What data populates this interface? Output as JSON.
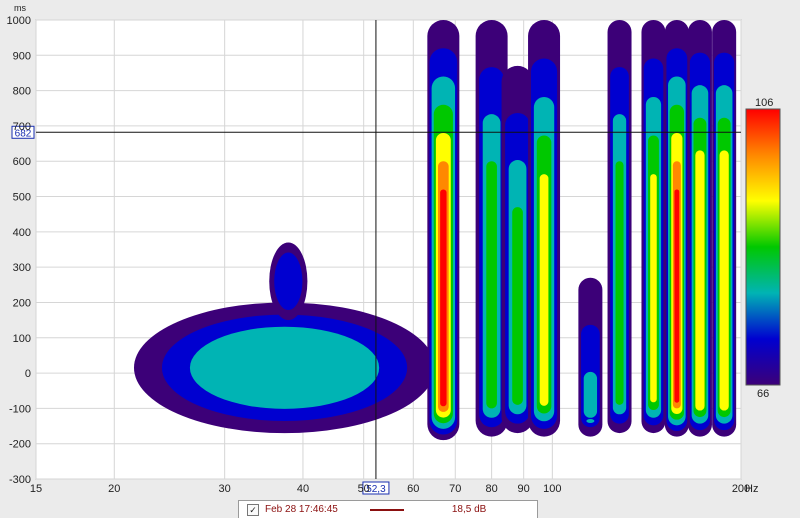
{
  "chart_data": {
    "type": "heatmap",
    "title": "",
    "xlabel": "",
    "ylabel": "",
    "x_unit": "Hz",
    "y_unit": "ms",
    "x_scale": "log",
    "xlim": [
      15,
      200
    ],
    "ylim": [
      -300,
      1000
    ],
    "x_ticks": [
      15,
      20,
      30,
      40,
      50,
      60,
      70,
      80,
      90,
      100,
      200
    ],
    "y_ticks": [
      -300,
      -200,
      -100,
      0,
      100,
      200,
      300,
      400,
      500,
      600,
      700,
      800,
      900,
      1000
    ],
    "color_scale": {
      "max": 106,
      "min": 66,
      "colors": [
        "#ff0000",
        "#ff8800",
        "#ffff00",
        "#00c800",
        "#00b4b4",
        "#0000d0",
        "#3c0078"
      ]
    },
    "cursor": {
      "x_value": "52,3",
      "y_value": "682"
    },
    "features": [
      {
        "kind": "region",
        "freq_range": [
          21.5,
          65
        ],
        "time_range": [
          -170,
          200
        ],
        "peak_level": 80
      },
      {
        "kind": "bump",
        "freq": 38,
        "time_range": [
          150,
          370
        ],
        "peak_level": 74
      },
      {
        "kind": "ridge",
        "freq": 67,
        "time_range": [
          -190,
          1000
        ],
        "peak_level": 104
      },
      {
        "kind": "ridge",
        "freq": 80,
        "time_range": [
          -180,
          1000
        ],
        "peak_level": 86
      },
      {
        "kind": "ridge",
        "freq": 88,
        "time_range": [
          -170,
          870
        ],
        "peak_level": 84
      },
      {
        "kind": "ridge",
        "freq": 97,
        "time_range": [
          -180,
          1000
        ],
        "peak_level": 90
      },
      {
        "kind": "ridge",
        "freq": 115,
        "time_range": [
          -180,
          270
        ],
        "peak_level": 82
      },
      {
        "kind": "ridge",
        "freq": 128,
        "time_range": [
          -170,
          1000
        ],
        "peak_level": 86
      },
      {
        "kind": "ridge",
        "freq": 145,
        "time_range": [
          -170,
          1000
        ],
        "peak_level": 92
      },
      {
        "kind": "ridge",
        "freq": 158,
        "time_range": [
          -180,
          1000
        ],
        "peak_level": 104
      },
      {
        "kind": "ridge",
        "freq": 172,
        "time_range": [
          -180,
          1000
        ],
        "peak_level": 96
      },
      {
        "kind": "ridge",
        "freq": 188,
        "time_range": [
          -180,
          1000
        ],
        "peak_level": 94
      }
    ]
  },
  "legend": {
    "checked": "✓",
    "label": "Feb 28 17:46:45",
    "value": "18,5 dB"
  }
}
